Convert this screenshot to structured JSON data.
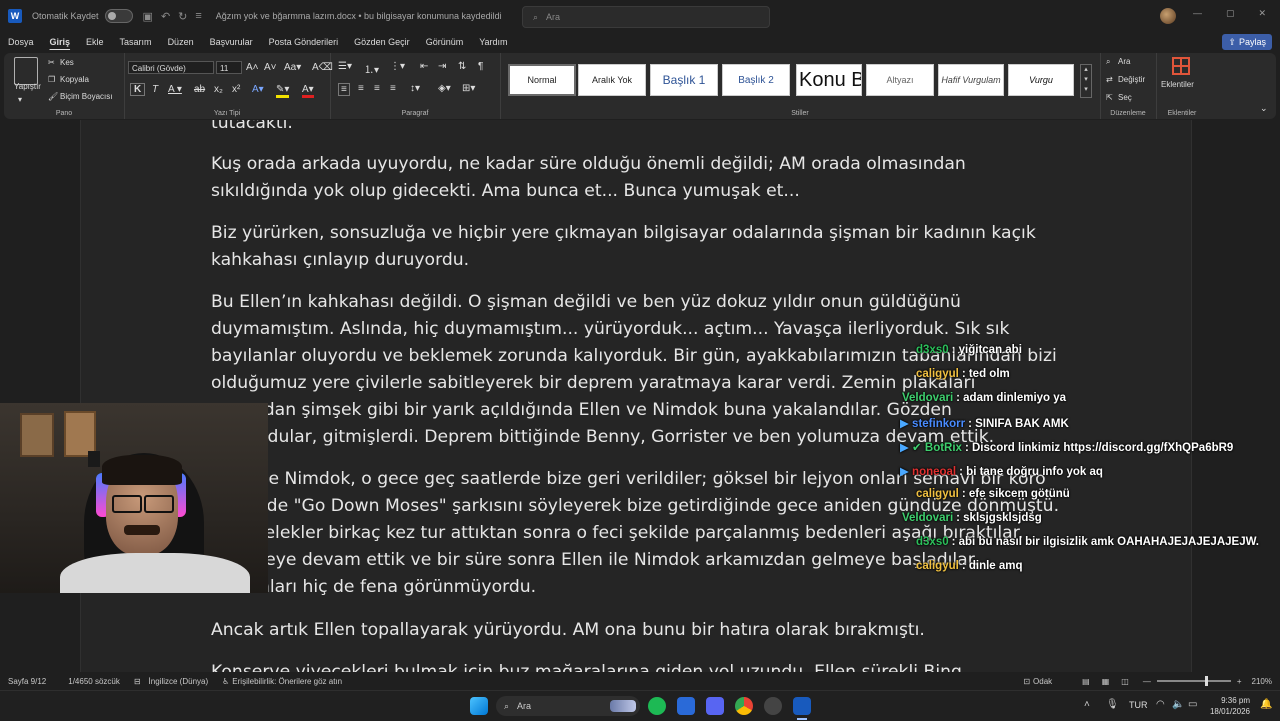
{
  "titlebar": {
    "autosave_label": "Otomatik Kaydet",
    "doc_title": "Ağzım yok  ve bğarmma lazım.docx  •  bu bilgisayar konumuna kaydedildi",
    "search_placeholder": "Ara"
  },
  "menu": [
    "Dosya",
    "Giriş",
    "Ekle",
    "Tasarım",
    "Düzen",
    "Başvurular",
    "Posta Gönderileri",
    "Gözden Geçir",
    "Görünüm",
    "Yardım"
  ],
  "share_label": "Paylaş",
  "ribbon": {
    "paste": "Yapıştır",
    "cut": "Kes",
    "copy": "Kopyala",
    "format_painter": "Biçim Boyacısı",
    "clipboard_group": "Pano",
    "font_name": "Calibri (Gövde)",
    "font_size": "11",
    "font_group": "Yazı Tipi",
    "paragraph_group": "Paragraf",
    "styles_group": "Stiller",
    "styles": [
      "Normal",
      "Aralık Yok",
      "Başlık 1",
      "Başlık 2",
      "Konu Başlığı",
      "Altyazı",
      "Hafif Vurgulam",
      "Vurgu"
    ],
    "find": "Ara",
    "replace": "Değiştir",
    "select": "Seç",
    "editing_group": "Düzenleme",
    "addins": "Eklentiler",
    "addins_group": "Eklentiler"
  },
  "document": {
    "paragraphs": [
      "tutacaktı.",
      "Kuş orada arkada uyuyordu, ne kadar süre olduğu önemli değildi; AM orada olmasından sıkıldığında yok olup gidecekti. Ama bunca et... Bunca yumuşak et...",
      "Biz yürürken, sonsuzluğa ve hiçbir yere çıkmayan bilgisayar odalarında şişman bir kadının kaçık kahkahası çınlayıp duruyordu.",
      "Bu Ellen’ın kahkahası değildi. O şişman değildi ve ben yüz dokuz yıldır onun güldüğünü duymamıştım. Aslında, hiç duymamıştım... yürüyorduk... açtım... Yavaşça ilerliyorduk. Sık sık bayılanlar oluyordu ve beklemek zorunda kalıyorduk. Bir gün, ayakkabılarımızın tabanlarından bizi olduğumuz yere çivilerle sabitleyerek bir deprem yaratmaya karar verdi. Zemin plakaları arasından şimşek gibi bir yarık açıldığında Ellen ve Nimdok buna yakalandılar. Gözden kayboldular, gitmişlerdi. Deprem bittiğinde Benny, Gorrister ve ben yolumuza devam ettik.",
      "Ellen ve Nimdok, o gece geç saatlerde bize geri verildiler; göksel bir lejyon onları semavi bir koro eşliğinde \"Go Down Moses\" şarkısını söyleyerek bize getirdiğinde gece aniden gündüze dönmüştü. Baş melekler birkaç kez tur attıktan sonra o feci şekilde parçalanmış bedenleri aşağı bıraktılar. Yürümeye devam ettik ve bir süre sonra Ellen ile Nimdok arkamızdan gelmeye başladılar. Durumları hiç de fena görünmüyordu.",
      "Ancak artık Ellen topallayarak yürüyordu. AM ona bunu bir hatıra olarak bırakmıştı.",
      "Konserve yiyecekleri bulmak için buz mağaralarına giden yol uzundu. Ellen sürekli Bing kirazlarından"
    ]
  },
  "chat": [
    {
      "user": "d3xs0",
      "msg": ": yiğitcan abi",
      "color": "#2bbf5a",
      "icon": "sword"
    },
    {
      "user": "caligyul",
      "msg": ": ted olm",
      "color": "#f0c040",
      "icon": "dot"
    },
    {
      "user": "Veldovari",
      "msg": ": adam dinlemiyo ya",
      "color": "#3ecf6e",
      "icon": "none"
    },
    {
      "user": "stefinkorr",
      "msg": ": SINIFA BAK AMK",
      "color": "#4a8cff",
      "icon": "badge"
    },
    {
      "user": "BotRix",
      "msg": ": Discord linkimiz https://discord.gg/fXhQPa6bR9",
      "color": "#3ecf6e",
      "icon": "bot"
    },
    {
      "user": "noneoal",
      "msg": ": bi tane doğru info yok aq",
      "color": "#e03030",
      "icon": "badge"
    },
    {
      "user": "caligyul",
      "msg": ": efe sikcem götünü",
      "color": "#f0c040",
      "icon": "dot"
    },
    {
      "user": "Veldovari",
      "msg": ": sklsjgsklsjdsg",
      "color": "#3ecf6e",
      "icon": "none"
    },
    {
      "user": "d3xs0",
      "msg": ": abi bu nasıl bir ilgisizlik amk OAHAHAJEJAJEJAJEJW.",
      "color": "#2bbf5a",
      "icon": "sword"
    },
    {
      "user": "caligyul",
      "msg": ": dinle amq",
      "color": "#f0c040",
      "icon": "dot"
    }
  ],
  "status": {
    "page": "Sayfa 9/12",
    "words": "1/4650 sözcük",
    "language": "İngilizce (Dünya)",
    "accessibility": "Erişilebilirlik: Önerilere göz atın",
    "focus": "Odak",
    "zoom": "210%"
  },
  "taskbar": {
    "search": "Ara",
    "lang": "TUR",
    "time": "9:36 pm",
    "date": "18/01/2026"
  }
}
